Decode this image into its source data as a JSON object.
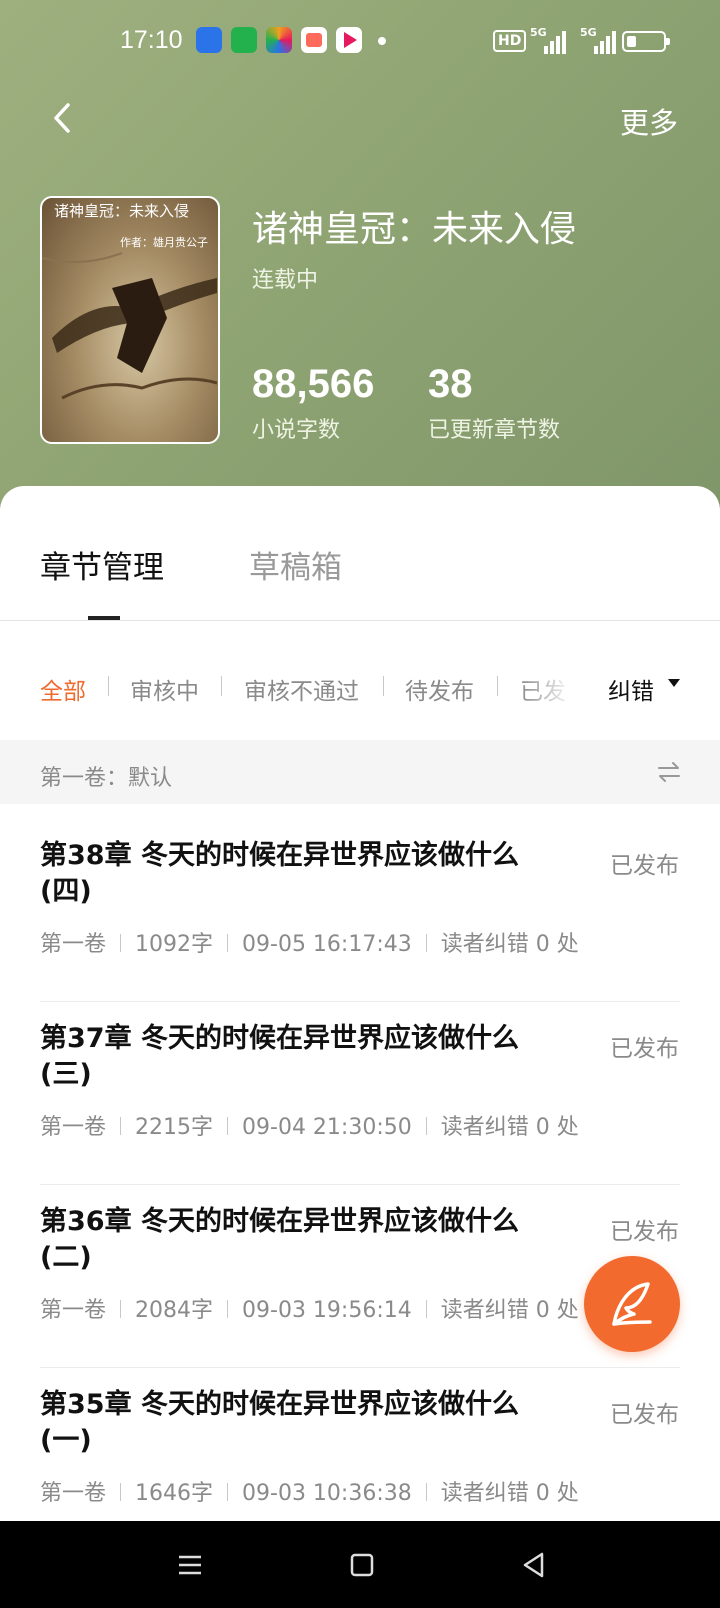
{
  "status_bar": {
    "time": "17:10",
    "hd_badge": "HD",
    "signal_1": "5G",
    "signal_2": "5G",
    "app_icon_colors": [
      "#2a73e8",
      "#22b14c",
      "#f0a020",
      "#ff6b5b",
      "#e8185c"
    ]
  },
  "header": {
    "more_label": "更多"
  },
  "book": {
    "cover_title": "诸神皇冠：未来入侵",
    "cover_author": "作者：雄月贵公子",
    "title": "诸神皇冠：未来入侵",
    "status": "连载中",
    "word_count": "88,566",
    "word_count_label": "小说字数",
    "chapters_count": "38",
    "chapters_count_label": "已更新章节数"
  },
  "tabs": [
    {
      "label": "章节管理",
      "active": true
    },
    {
      "label": "草稿箱",
      "active": false
    }
  ],
  "filters": [
    {
      "label": "全部",
      "active": true
    },
    {
      "label": "审核中",
      "active": false
    },
    {
      "label": "审核不通过",
      "active": false
    },
    {
      "label": "待发布",
      "active": false
    },
    {
      "label": "已发",
      "active": false
    }
  ],
  "sort": {
    "label": "纠错"
  },
  "volume": {
    "label": "第一卷：默认"
  },
  "chapters": [
    {
      "title": "第38章 冬天的时候在异世界应该做什么(四)",
      "status": "已发布",
      "volume": "第一卷",
      "words": "1092字",
      "time": "09-05 16:17:43",
      "corrections": "读者纠错 0 处"
    },
    {
      "title": "第37章 冬天的时候在异世界应该做什么(三)",
      "status": "已发布",
      "volume": "第一卷",
      "words": "2215字",
      "time": "09-04 21:30:50",
      "corrections": "读者纠错 0 处"
    },
    {
      "title": "第36章 冬天的时候在异世界应该做什么(二)",
      "status": "已发布",
      "volume": "第一卷",
      "words": "2084字",
      "time": "09-03 19:56:14",
      "corrections": "读者纠错 0 处"
    },
    {
      "title": "第35章 冬天的时候在异世界应该做什么(一)",
      "status": "已发布",
      "volume": "第一卷",
      "words": "1646字",
      "time": "09-03 10:36:38",
      "corrections": "读者纠错 0 处"
    }
  ],
  "colors": {
    "accent": "#f26a2e",
    "header_green": "#8ea372"
  }
}
